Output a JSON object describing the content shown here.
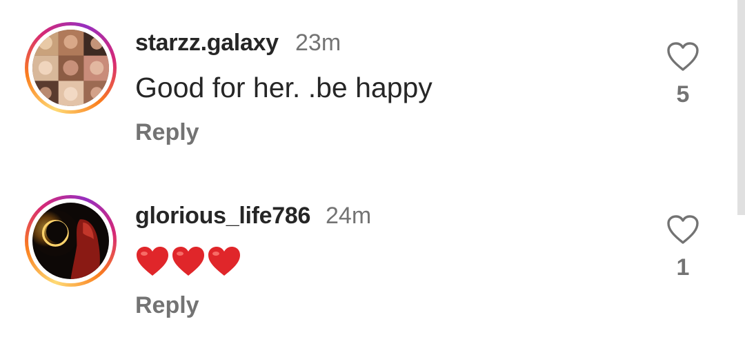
{
  "comments": [
    {
      "username": "starzz.galaxy",
      "time": "23m",
      "text": "Good for her. .be happy",
      "reply_label": "Reply",
      "likes": "5",
      "avatar": "collage-portrait-avatar"
    },
    {
      "username": "glorious_life786",
      "time": "24m",
      "text": "",
      "emoji": [
        "red-heart",
        "red-heart",
        "red-heart"
      ],
      "reply_label": "Reply",
      "likes": "1",
      "avatar": "eclipse-figure-avatar"
    }
  ],
  "colors": {
    "primary_text": "#262626",
    "secondary_text": "#737373",
    "heart_red": "#e0262a",
    "story_ring": [
      "#feda75",
      "#fa7e1e",
      "#d62976",
      "#962fbf"
    ]
  }
}
